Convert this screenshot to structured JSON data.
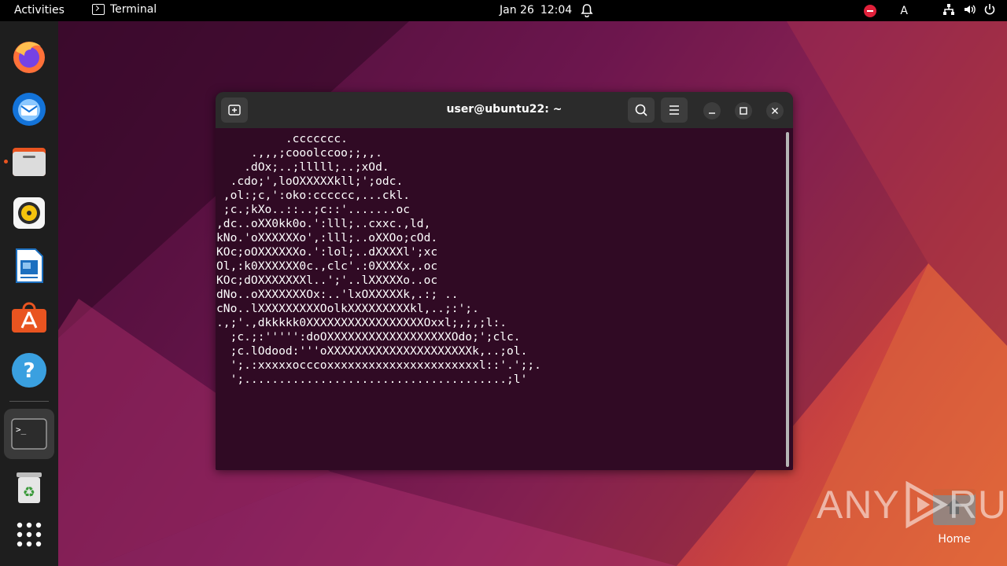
{
  "topbar": {
    "activities": "Activities",
    "app_name": "Terminal",
    "date": "Jan 26",
    "time": "12:04",
    "keyboard_layout": "A"
  },
  "dock": {
    "items": [
      {
        "name": "Firefox",
        "icon": "firefox-icon"
      },
      {
        "name": "Thunderbird",
        "icon": "thunderbird-icon"
      },
      {
        "name": "Files",
        "icon": "files-icon",
        "running": true
      },
      {
        "name": "Rhythmbox",
        "icon": "rhythmbox-icon"
      },
      {
        "name": "LibreOffice Writer",
        "icon": "writer-icon"
      },
      {
        "name": "Ubuntu Software",
        "icon": "software-icon"
      },
      {
        "name": "Help",
        "icon": "help-icon"
      },
      {
        "name": "Terminal",
        "icon": "terminal-icon",
        "running": true,
        "active": true
      },
      {
        "name": "Trash",
        "icon": "trash-icon"
      },
      {
        "name": "Show Applications",
        "icon": "app-grid-icon"
      }
    ]
  },
  "terminal": {
    "title": "user@ubuntu22: ~",
    "output": "          .ccccccc.\n     .,,,;cooolccoo;;,,.\n    .dOx;..;lllll;..;xOd.\n  .cdo;',loOXXXXXkll;';odc.\n ,ol:;c,':oko:cccccc,...ckl.\n ;c.;kXo..::..;c::'.......oc\n,dc..oXX0kk0o.':lll;..cxxc.,ld,\nkNo.'oXXXXXXo',:lll;..oXXOo;cOd.\nKOc;oOXXXXXXo.':lol;..dXXXXl';xc\nOl,:k0XXXXXX0c.,clc'.:0XXXXx,.oc\nKOc;dOXXXXXXXl..';'..lXXXXXo..oc\ndNo..oXXXXXXXOx:..'lxOXXXXXk,.:; ..\ncNo..lXXXXXXXXXOolkXXXXXXXXXkl,..;:';.\n.,;'.,dkkkkk0XXXXXXXXXXXXXXXXXOxxl;,;,;l:.\n  ;c.;:''''':doOXXXXXXXXXXXXXXXXXXOdo;';clc.\n  ;c.lOdood:'''oXXXXXXXXXXXXXXXXXXXXXk,..;ol.\n  ';.:xxxxxocccoxxxxxxxxxxxxxxxxxxxxxxl::'.';;.\n  ';......................................;l'"
  },
  "desktop": {
    "home_label": "Home"
  },
  "watermark": {
    "text_left": "ANY",
    "text_right": "RUN"
  },
  "colors": {
    "terminal_bg": "#300a24",
    "header_bg": "#2b2b2b",
    "accent": "#e95420"
  }
}
